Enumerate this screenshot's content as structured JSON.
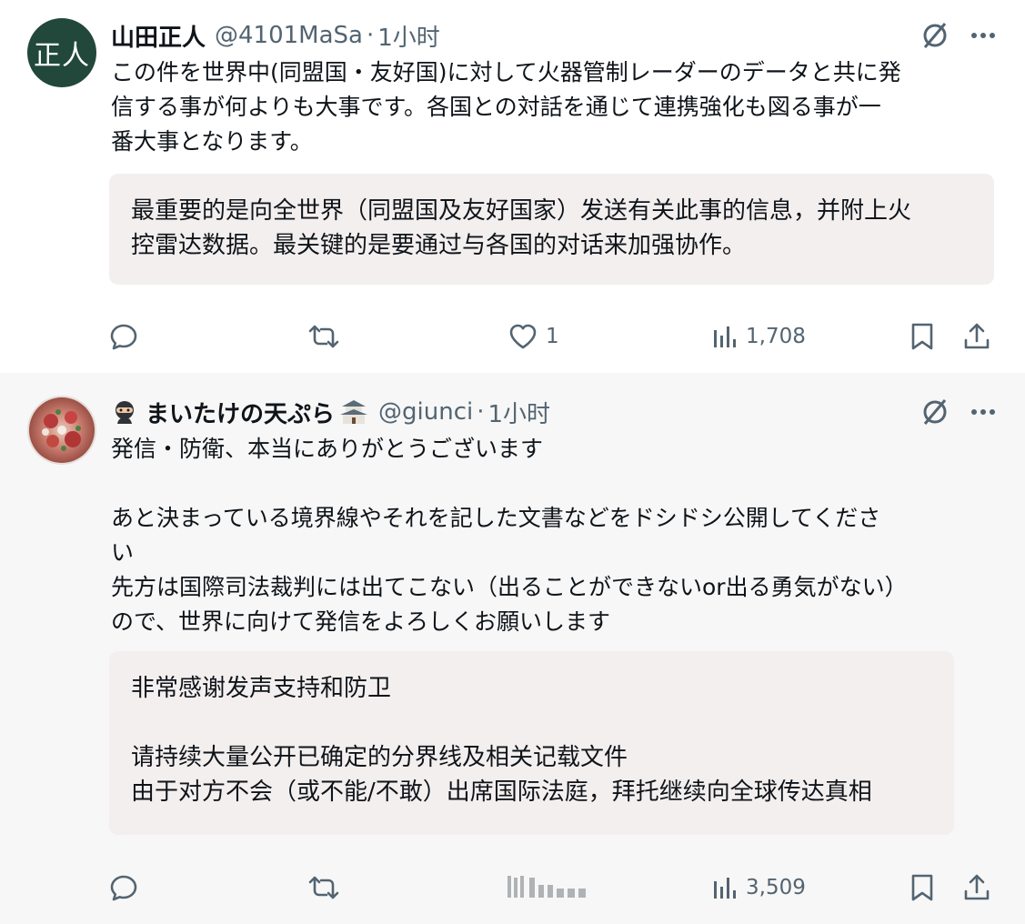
{
  "tweets": [
    {
      "avatar_text": "正人",
      "display_name": "山田正人",
      "handle": "@4101MaSa",
      "separator": "·",
      "time": "1小时",
      "body": "この件を世界中(同盟国・友好国)に対して火器管制レーダーのデータと共に発\n信する事が何よりも大事です。各国との対話を通じて連携強化も図る事が一\n番大事となります。",
      "translation": "最重要的是向全世界（同盟国及友好国家）发送有关此事的信息，并附上火\n控雷达数据。最关键的是要通过与各国的对话来加强协作。",
      "likes": "1",
      "views": "1,708",
      "avatar_color": "#21483a"
    },
    {
      "avatar_icon": "pizza-avatar",
      "display_name": "まいたけの天ぷら",
      "name_prefix_icon": "ninja-emoji",
      "name_suffix_icon": "castle-emoji",
      "handle": "@giunci",
      "separator": "·",
      "time": "1小时",
      "body": "発信・防衛、本当にありがとうございます\n\nあと決まっている境界線やそれを記した文書などをドシドシ公開してくださ\nい\n先方は国際司法裁判には出てこない（出ることができないor出る勇気がない）\nので、世界に向けて発信をよろしくお願いします",
      "translation": "非常感谢发声支持和防卫\n\n请持续大量公开已确定的分界线及相关记载文件\n由于对方不会（或不能/不敢）出席国际法庭，拜托继续向全球传达真相",
      "views": "3,509"
    }
  ],
  "colors": {
    "text": "#0f1419",
    "secondary": "#536471",
    "translation_bg": "#f4efef",
    "second_bg": "#f7f7f7"
  }
}
